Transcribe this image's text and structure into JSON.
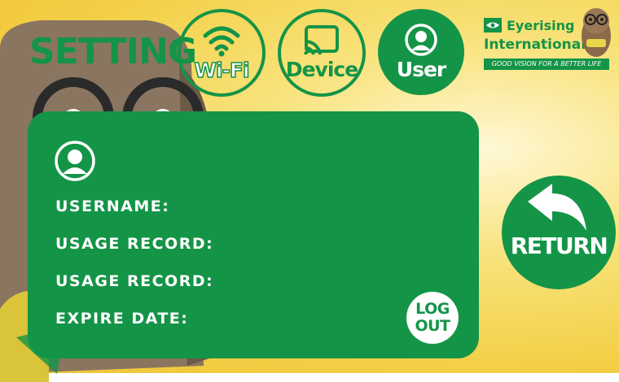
{
  "header": {
    "title": "SETTING"
  },
  "tabs": [
    {
      "id": "wifi",
      "label": "Wi-Fi",
      "icon": "wifi-icon",
      "active": false
    },
    {
      "id": "device",
      "label": "Device",
      "icon": "cast-icon",
      "active": false
    },
    {
      "id": "user",
      "label": "User",
      "icon": "user-icon",
      "active": true
    }
  ],
  "logo": {
    "line1": "Eyerising",
    "line2": "International",
    "tagline": "GOOD VISION FOR A BETTER LIFE"
  },
  "user_panel": {
    "icon": "user-icon",
    "fields": [
      {
        "label": "USERNAME:",
        "value": ""
      },
      {
        "label": "USAGE RECORD:",
        "value": ""
      },
      {
        "label": "USAGE RECORD:",
        "value": ""
      },
      {
        "label": "EXPIRE DATE:",
        "value": ""
      }
    ],
    "logout": {
      "line1": "LOG",
      "line2": "OUT"
    }
  },
  "return_button": {
    "label": "RETURN",
    "icon": "return-arrow-icon"
  },
  "colors": {
    "primary": "#149447",
    "background": "#f3cf45",
    "text_on_primary": "#ffffff"
  }
}
